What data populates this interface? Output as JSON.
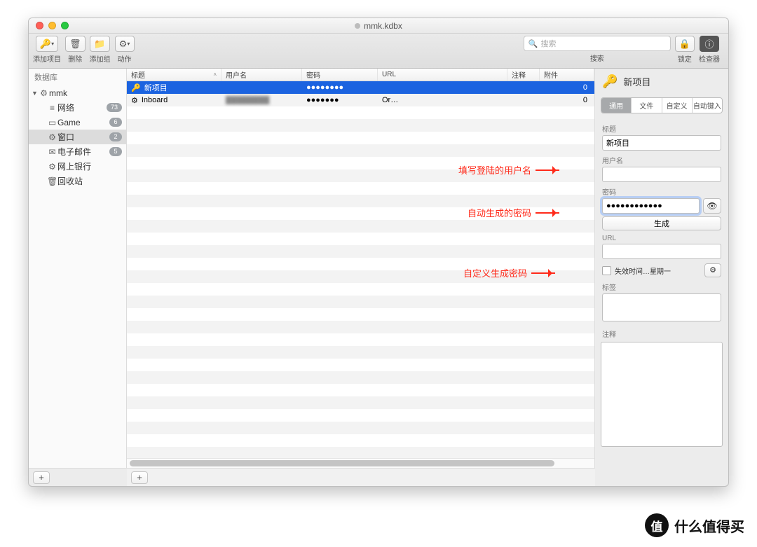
{
  "window": {
    "title": "mmk.kdbx"
  },
  "toolbar": {
    "add_entry": "添加项目",
    "delete": "删除",
    "add_group": "添加组",
    "actions": "动作",
    "search_placeholder": "搜索",
    "search_label": "搜索",
    "lock": "锁定",
    "inspector": "检查器"
  },
  "sidebar": {
    "header": "数据库",
    "root": "mmk",
    "items": [
      {
        "icon": "≡",
        "label": "网络",
        "badge": "73"
      },
      {
        "icon": "▭",
        "label": "Game",
        "badge": "6"
      },
      {
        "icon": "⚙",
        "label": "窗口",
        "badge": "2",
        "selected": true
      },
      {
        "icon": "✉",
        "label": "电子邮件",
        "badge": "5"
      },
      {
        "icon": "⚙",
        "label": "网上银行",
        "badge": ""
      },
      {
        "icon": "🗑",
        "label": "回收站",
        "badge": ""
      }
    ]
  },
  "columns": {
    "title": "标题",
    "user": "用户名",
    "pass": "密码",
    "url": "URL",
    "note": "注释",
    "att": "附件"
  },
  "entries": [
    {
      "icon": "🔑",
      "title": "新项目",
      "user": "",
      "pass": "●●●●●●●●",
      "url": "",
      "att": "0",
      "selected": true
    },
    {
      "icon": "⚙",
      "title": "Inboard",
      "user": "████████",
      "pass": "●●●●●●●",
      "url": "Or…",
      "att": "0"
    }
  ],
  "inspector": {
    "header": "新项目",
    "tabs": [
      "通用",
      "文件",
      "自定义",
      "自动键入"
    ],
    "active_tab": 0,
    "labels": {
      "title": "标题",
      "user": "用户名",
      "pass": "密码",
      "url": "URL",
      "tags": "标签",
      "notes": "注释"
    },
    "title_value": "新项目",
    "pass_value": "●●●●●●●●●●●●",
    "generate": "生成",
    "expire": "失效时间…星期一"
  },
  "annotations": {
    "a1": "填写登陆的用户名",
    "a2": "自动生成的密码",
    "a3": "自定义生成密码"
  },
  "watermark": "什么值得买"
}
